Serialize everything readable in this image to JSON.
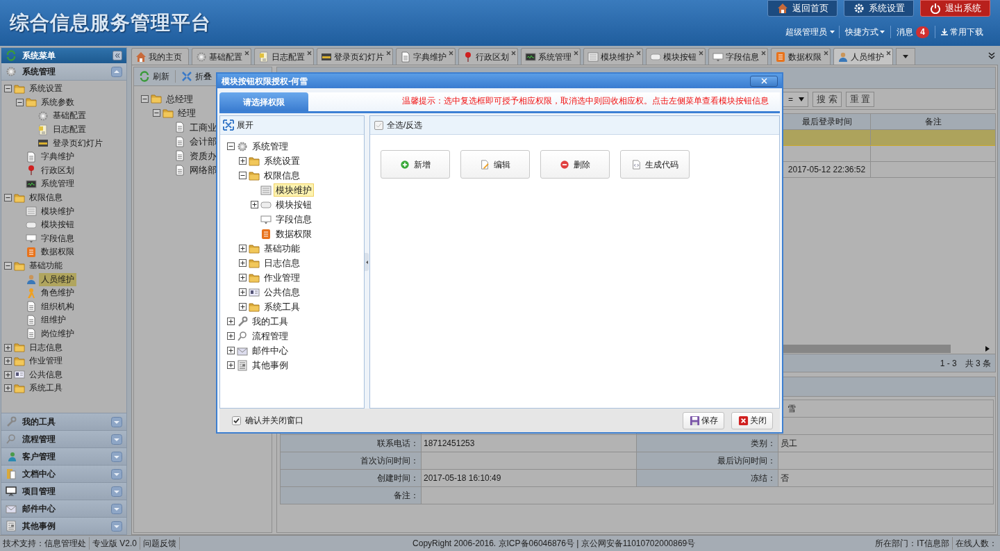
{
  "header": {
    "title": "综合信息服务管理平台",
    "buttons": [
      {
        "label": "返回首页",
        "kind": "home"
      },
      {
        "label": "系统设置",
        "kind": "settings"
      },
      {
        "label": "退出系统",
        "kind": "logout"
      }
    ],
    "user_menu": "超级管理员",
    "shortcuts": "快捷方式",
    "messages": {
      "label": "消息",
      "count": "4"
    },
    "downloads": "常用下载"
  },
  "sidebar": {
    "title": "系统菜单",
    "open_panel": "系统管理",
    "tree": [
      {
        "label": "系统设置",
        "kind": "folder",
        "expanded": true,
        "selected": false,
        "children": [
          {
            "label": "系统参数",
            "kind": "folder",
            "expanded": true,
            "selected": false,
            "children": [
              {
                "label": "基础配置",
                "kind": "gear",
                "selected": false
              },
              {
                "label": "日志配置",
                "kind": "note",
                "selected": false
              },
              {
                "label": "登录页幻灯片",
                "kind": "slide",
                "selected": false
              }
            ]
          },
          {
            "label": "字典维护",
            "kind": "page",
            "selected": false
          },
          {
            "label": "行政区划",
            "kind": "pin",
            "selected": false
          },
          {
            "label": "系统管理",
            "kind": "monitor",
            "selected": false
          }
        ]
      },
      {
        "label": "权限信息",
        "kind": "folder",
        "expanded": true,
        "selected": false,
        "children": [
          {
            "label": "模块维护",
            "kind": "list",
            "selected": false
          },
          {
            "label": "模块按钮",
            "kind": "button",
            "selected": false
          },
          {
            "label": "字段信息",
            "kind": "field",
            "selected": false
          },
          {
            "label": "数据权限",
            "kind": "data",
            "selected": false
          }
        ]
      },
      {
        "label": "基础功能",
        "kind": "folder",
        "expanded": true,
        "selected": false,
        "children": [
          {
            "label": "人员维护",
            "kind": "person",
            "selected": true
          },
          {
            "label": "角色维护",
            "kind": "role",
            "selected": false
          },
          {
            "label": "组织机构",
            "kind": "page",
            "selected": false
          },
          {
            "label": "组维护",
            "kind": "page",
            "selected": false
          },
          {
            "label": "岗位维护",
            "kind": "page",
            "selected": false
          }
        ]
      },
      {
        "label": "日志信息",
        "kind": "folder",
        "expanded": false,
        "selected": false
      },
      {
        "label": "作业管理",
        "kind": "folder",
        "expanded": false,
        "selected": false
      },
      {
        "label": "公共信息",
        "kind": "card",
        "expanded": false,
        "selected": false
      },
      {
        "label": "系统工具",
        "kind": "folder",
        "expanded": false,
        "selected": false
      }
    ],
    "panels": [
      {
        "label": "我的工具",
        "kind": "wrench"
      },
      {
        "label": "流程管理",
        "kind": "flow"
      },
      {
        "label": "客户管理",
        "kind": "people"
      },
      {
        "label": "文档中心",
        "kind": "docs"
      },
      {
        "label": "项目管理",
        "kind": "board"
      },
      {
        "label": "邮件中心",
        "kind": "mail"
      },
      {
        "label": "其他事例",
        "kind": "news"
      }
    ]
  },
  "tabs": [
    {
      "label": "我的主页",
      "kind": "home",
      "selected": false,
      "closable": false
    },
    {
      "label": "基础配置",
      "kind": "gear",
      "selected": false,
      "closable": true
    },
    {
      "label": "日志配置",
      "kind": "note",
      "selected": false,
      "closable": true
    },
    {
      "label": "登录页幻灯片",
      "kind": "slide",
      "selected": false,
      "closable": true
    },
    {
      "label": "字典维护",
      "kind": "page",
      "selected": false,
      "closable": true
    },
    {
      "label": "行政区划",
      "kind": "pin",
      "selected": false,
      "closable": true
    },
    {
      "label": "系统管理",
      "kind": "monitor",
      "selected": false,
      "closable": true
    },
    {
      "label": "模块维护",
      "kind": "list",
      "selected": false,
      "closable": true
    },
    {
      "label": "模块按钮",
      "kind": "button",
      "selected": false,
      "closable": true
    },
    {
      "label": "字段信息",
      "kind": "field",
      "selected": false,
      "closable": true
    },
    {
      "label": "数据权限",
      "kind": "data",
      "selected": false,
      "closable": true
    },
    {
      "label": "人员维护",
      "kind": "person",
      "selected": true,
      "closable": true
    }
  ],
  "org_panel": {
    "toolbar": [
      {
        "label": "刷新",
        "kind": "refresh"
      },
      {
        "label": "折叠",
        "kind": "collapse"
      }
    ],
    "tree": [
      {
        "label": "总经理",
        "kind": "folder",
        "expanded": true,
        "children": [
          {
            "label": "经理",
            "kind": "folder",
            "expanded": true,
            "children": [
              {
                "label": "工商业",
                "kind": "page"
              },
              {
                "label": "会计部",
                "kind": "page"
              },
              {
                "label": "资质办",
                "kind": "page"
              },
              {
                "label": "网络部",
                "kind": "page"
              }
            ]
          }
        ]
      }
    ]
  },
  "grid": {
    "search": {
      "operator": "=",
      "buttons": [
        "搜 索",
        "重 置"
      ]
    },
    "columns": [
      "最后登录时间",
      "备注"
    ],
    "rows": [
      {
        "selected": true
      },
      {
        "selected": false
      },
      {
        "selected": false,
        "last_login": "2017-05-12 22:36:52"
      }
    ],
    "pager": {
      "range": "1 - 3",
      "total": "共 3 条"
    }
  },
  "detail": {
    "name_fragment": "雪",
    "rows": [
      [
        {
          "label": "联系电话：",
          "value": "18712451253"
        },
        {
          "label": "类别：",
          "value": "员工"
        }
      ],
      [
        {
          "label": "首次访问时间："
        },
        {
          "label": "最后访问时间："
        }
      ],
      [
        {
          "label": "创建时间：",
          "value": "2017-05-18 16:10:49"
        },
        {
          "label": "冻结：",
          "value": "否"
        }
      ],
      [
        {
          "label": "备注："
        }
      ]
    ]
  },
  "dialog": {
    "title": "模块按钮权限授权-何雪",
    "tabs": [
      {
        "label": "请选择权限",
        "selected": true
      }
    ],
    "hint": "温馨提示：选中复选框即可授予相应权限，取消选中则回收相应权。点击左侧菜单查看模块按钮信息",
    "expand_label": "展开",
    "tree": [
      {
        "label": "系统管理",
        "kind": "gear",
        "expanded": true,
        "selected": false,
        "children": [
          {
            "label": "系统设置",
            "kind": "folder",
            "expanded": false,
            "selected": false
          },
          {
            "label": "权限信息",
            "kind": "folder",
            "expanded": true,
            "selected": false,
            "children": [
              {
                "label": "模块维护",
                "kind": "list",
                "selected": true
              },
              {
                "label": "模块按钮",
                "kind": "button",
                "expanded": false,
                "selected": false
              },
              {
                "label": "字段信息",
                "kind": "field",
                "selected": false
              },
              {
                "label": "数据权限",
                "kind": "data",
                "selected": false
              }
            ]
          },
          {
            "label": "基础功能",
            "kind": "folder",
            "expanded": false,
            "selected": false
          },
          {
            "label": "日志信息",
            "kind": "folder",
            "expanded": false,
            "selected": false
          },
          {
            "label": "作业管理",
            "kind": "folder",
            "expanded": false,
            "selected": false
          },
          {
            "label": "公共信息",
            "kind": "card",
            "expanded": false,
            "selected": false
          },
          {
            "label": "系统工具",
            "kind": "folder",
            "expanded": false,
            "selected": false
          }
        ]
      },
      {
        "label": "我的工具",
        "kind": "wrench",
        "expanded": false,
        "selected": false
      },
      {
        "label": "流程管理",
        "kind": "flow",
        "expanded": false,
        "selected": false
      },
      {
        "label": "邮件中心",
        "kind": "mail",
        "expanded": false,
        "selected": false
      },
      {
        "label": "其他事例",
        "kind": "news",
        "expanded": false,
        "selected": false
      }
    ],
    "select_all": {
      "label": "全选/反选",
      "checked": false
    },
    "permission_buttons": [
      {
        "label": "新增",
        "kind": "add"
      },
      {
        "label": "编辑",
        "kind": "edit"
      },
      {
        "label": "删除",
        "kind": "delete"
      },
      {
        "label": "生成代码",
        "kind": "code"
      }
    ],
    "confirm_close": {
      "label": "确认并关闭窗口",
      "checked": true
    },
    "buttons": [
      {
        "label": "保存",
        "kind": "save"
      },
      {
        "label": "关闭",
        "kind": "close"
      }
    ]
  },
  "status_bar": {
    "left": [
      "技术支持：信息管理处",
      "专业版 V2.0",
      "问题反馈"
    ],
    "center": "CopyRight 2006-2016. 京ICP备06046876号 | 京公网安备11010702000869号",
    "right": [
      "所在部门：IT信息部",
      "在线人数："
    ]
  }
}
